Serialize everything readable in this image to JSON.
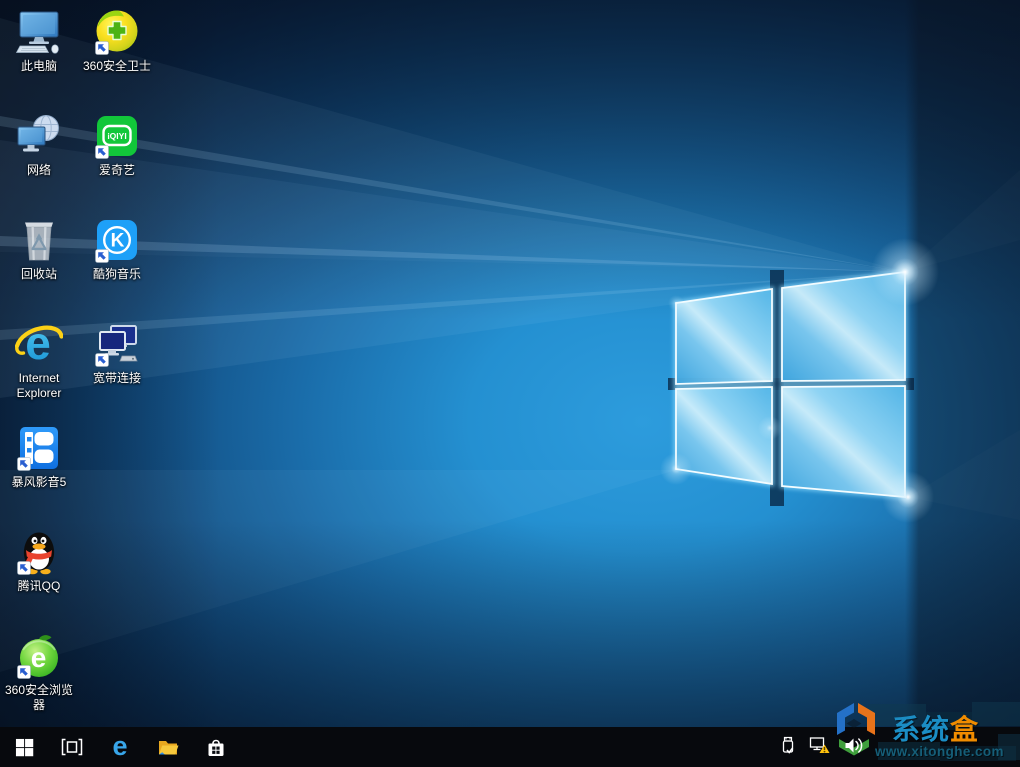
{
  "desktop": {
    "icons": [
      {
        "id": "this-pc",
        "label": "此电脑"
      },
      {
        "id": "360-safety-guard",
        "label": "360安全卫士"
      },
      {
        "id": "network",
        "label": "网络"
      },
      {
        "id": "iqiyi",
        "label": "爱奇艺"
      },
      {
        "id": "recycle-bin",
        "label": "回收站"
      },
      {
        "id": "kugou-music",
        "label": "酷狗音乐"
      },
      {
        "id": "internet-explorer",
        "label": "Internet Explorer"
      },
      {
        "id": "broadband",
        "label": "宽带连接"
      },
      {
        "id": "baofeng-player",
        "label": "暴风影音5"
      },
      {
        "id": "tencent-qq",
        "label": "腾讯QQ"
      },
      {
        "id": "360-browser",
        "label": "360安全浏览器"
      }
    ]
  },
  "icon_glyphs": {
    "iqiyi": "iQIYI",
    "kugou": "K",
    "internet_explorer": "e",
    "browser_360": "e",
    "edge": "e"
  },
  "taskbar": {
    "left_icons": [
      "start-icon",
      "task-view-icon",
      "edge-icon",
      "file-explorer-icon",
      "store-icon"
    ],
    "tray_icons": [
      "usb-icon",
      "network-warning-icon",
      "volume-icon"
    ]
  },
  "watermark": {
    "brand_blue_text": "系统",
    "brand_orange_text": "盒",
    "site_url": "www.xitonghe.com"
  },
  "colors": {
    "wallpaper_accent": "#2196d8",
    "taskbar_bg": "#07090d",
    "icon_label": "#ffffff",
    "watermark_blue": "#1b8dc4",
    "watermark_orange": "#f08c00",
    "watermark_url": "#155e78"
  }
}
